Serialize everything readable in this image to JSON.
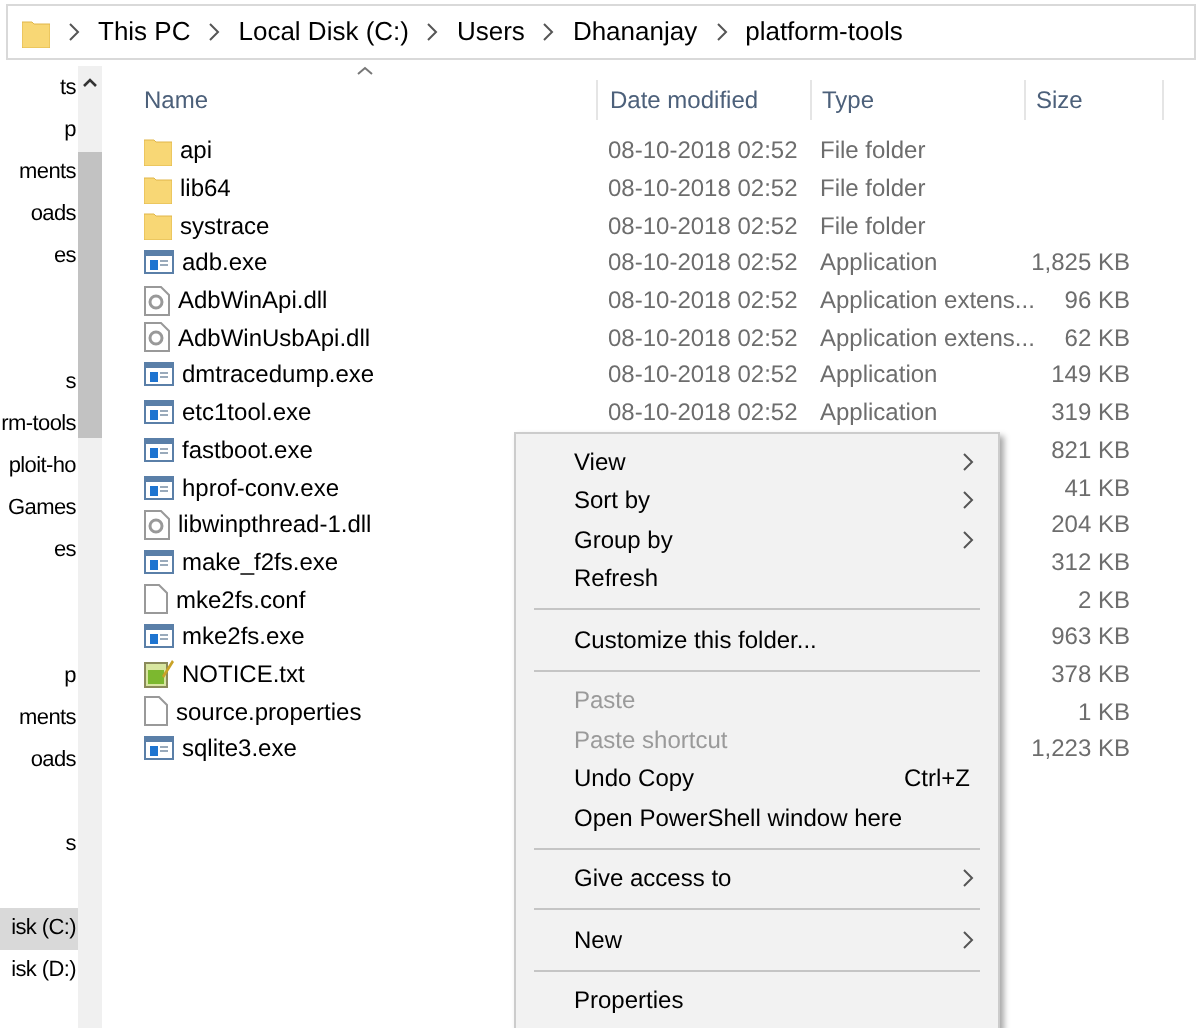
{
  "breadcrumb": [
    "This PC",
    "Local Disk (C:)",
    "Users",
    "Dhananjay",
    "platform-tools"
  ],
  "sidebar": {
    "groups": [
      [
        {
          "label": "ts",
          "selected": false
        },
        {
          "label": "p",
          "selected": false
        },
        {
          "label": "ments",
          "selected": false
        },
        {
          "label": "oads",
          "selected": false
        },
        {
          "label": "es",
          "selected": false
        }
      ],
      [
        {
          "label": "s",
          "selected": false
        },
        {
          "label": "rm-tools",
          "selected": false
        },
        {
          "label": "ploit-ho",
          "selected": false
        },
        {
          "label": "Games",
          "selected": false
        },
        {
          "label": "es",
          "selected": false
        }
      ],
      [
        {
          "label": "p",
          "selected": false
        },
        {
          "label": "ments",
          "selected": false
        },
        {
          "label": "oads",
          "selected": false
        }
      ],
      [
        {
          "label": "s",
          "selected": false
        }
      ],
      [
        {
          "label": "isk (C:)",
          "selected": true
        },
        {
          "label": "isk (D:)",
          "selected": false
        }
      ]
    ]
  },
  "table": {
    "columns": [
      "Name",
      "Date modified",
      "Type",
      "Size"
    ],
    "rows": [
      {
        "kind": "folder",
        "name": "api",
        "date": "08-10-2018 02:52",
        "type": "File folder"
      },
      {
        "kind": "folder",
        "name": "lib64",
        "date": "08-10-2018 02:52",
        "type": "File folder"
      },
      {
        "kind": "folder",
        "name": "systrace",
        "date": "08-10-2018 02:52",
        "type": "File folder"
      },
      {
        "kind": "exe",
        "name": "adb.exe",
        "date": "08-10-2018 02:52",
        "type": "Application",
        "size": "1,825 KB"
      },
      {
        "kind": "dll",
        "name": "AdbWinApi.dll",
        "date": "08-10-2018 02:52",
        "type": "Application extens...",
        "size": "96 KB"
      },
      {
        "kind": "dll",
        "name": "AdbWinUsbApi.dll",
        "date": "08-10-2018 02:52",
        "type": "Application extens...",
        "size": "62 KB"
      },
      {
        "kind": "exe",
        "name": "dmtracedump.exe",
        "date": "08-10-2018 02:52",
        "type": "Application",
        "size": "149 KB"
      },
      {
        "kind": "exe",
        "name": "etc1tool.exe",
        "date": "08-10-2018 02:52",
        "type": "Application",
        "size": "319 KB"
      },
      {
        "kind": "exe",
        "name": "fastboot.exe",
        "size": "821 KB"
      },
      {
        "kind": "exe",
        "name": "hprof-conv.exe",
        "size": "41 KB"
      },
      {
        "kind": "dll",
        "name": "libwinpthread-1.dll",
        "size": "204 KB"
      },
      {
        "kind": "exe",
        "name": "make_f2fs.exe",
        "size": "312 KB"
      },
      {
        "kind": "file",
        "name": "mke2fs.conf",
        "size": "2 KB"
      },
      {
        "kind": "exe",
        "name": "mke2fs.exe",
        "size": "963 KB"
      },
      {
        "kind": "txt",
        "name": "NOTICE.txt",
        "size": "378 KB"
      },
      {
        "kind": "file",
        "name": "source.properties",
        "size": "1 KB"
      },
      {
        "kind": "exe",
        "name": "sqlite3.exe",
        "size": "1,223 KB"
      }
    ]
  },
  "context_menu": [
    {
      "kind": "item",
      "label": "View",
      "disabled": false,
      "submenu": true
    },
    {
      "kind": "item",
      "label": "Sort by",
      "disabled": false,
      "submenu": true
    },
    {
      "kind": "item",
      "label": "Group by",
      "disabled": false,
      "submenu": true
    },
    {
      "kind": "item",
      "label": "Refresh",
      "disabled": false,
      "submenu": false
    },
    {
      "kind": "separator"
    },
    {
      "kind": "item",
      "label": "Customize this folder...",
      "disabled": false,
      "submenu": false
    },
    {
      "kind": "separator"
    },
    {
      "kind": "item",
      "label": "Paste",
      "disabled": true,
      "submenu": false
    },
    {
      "kind": "item",
      "label": "Paste shortcut",
      "disabled": true,
      "submenu": false
    },
    {
      "kind": "item",
      "label": "Undo Copy",
      "disabled": false,
      "submenu": false,
      "shortcut": "Ctrl+Z"
    },
    {
      "kind": "item",
      "label": "Open PowerShell window here",
      "disabled": false,
      "submenu": false
    },
    {
      "kind": "separator"
    },
    {
      "kind": "item",
      "label": "Give access to",
      "disabled": false,
      "submenu": true
    },
    {
      "kind": "separator"
    },
    {
      "kind": "item",
      "label": "New",
      "disabled": false,
      "submenu": true
    },
    {
      "kind": "separator"
    },
    {
      "kind": "item",
      "label": "Properties",
      "disabled": false,
      "submenu": false
    }
  ]
}
